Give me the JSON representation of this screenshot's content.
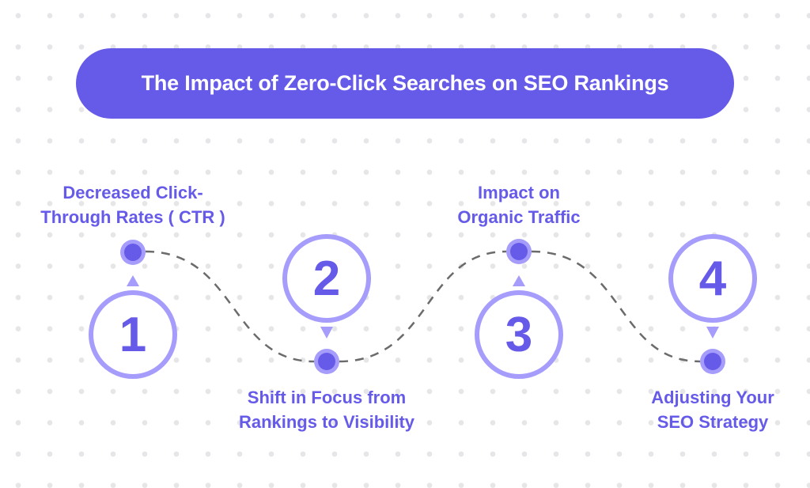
{
  "title": "The Impact of Zero-Click Searches on SEO Rankings",
  "colors": {
    "primary": "#665ae9",
    "ring": "#a59cfb",
    "dash": "#6b6b6b",
    "background_dots": "#e6e6e9"
  },
  "steps": [
    {
      "number": "1",
      "label_line1": "Decreased Click-",
      "label_line2": "Through Rates ( CTR )"
    },
    {
      "number": "2",
      "label_line1": "Shift in Focus from",
      "label_line2": "Rankings to Visibility"
    },
    {
      "number": "3",
      "label_line1": "Impact on",
      "label_line2": "Organic Traffic"
    },
    {
      "number": "4",
      "label_line1": "Adjusting Your",
      "label_line2": "SEO Strategy"
    }
  ]
}
